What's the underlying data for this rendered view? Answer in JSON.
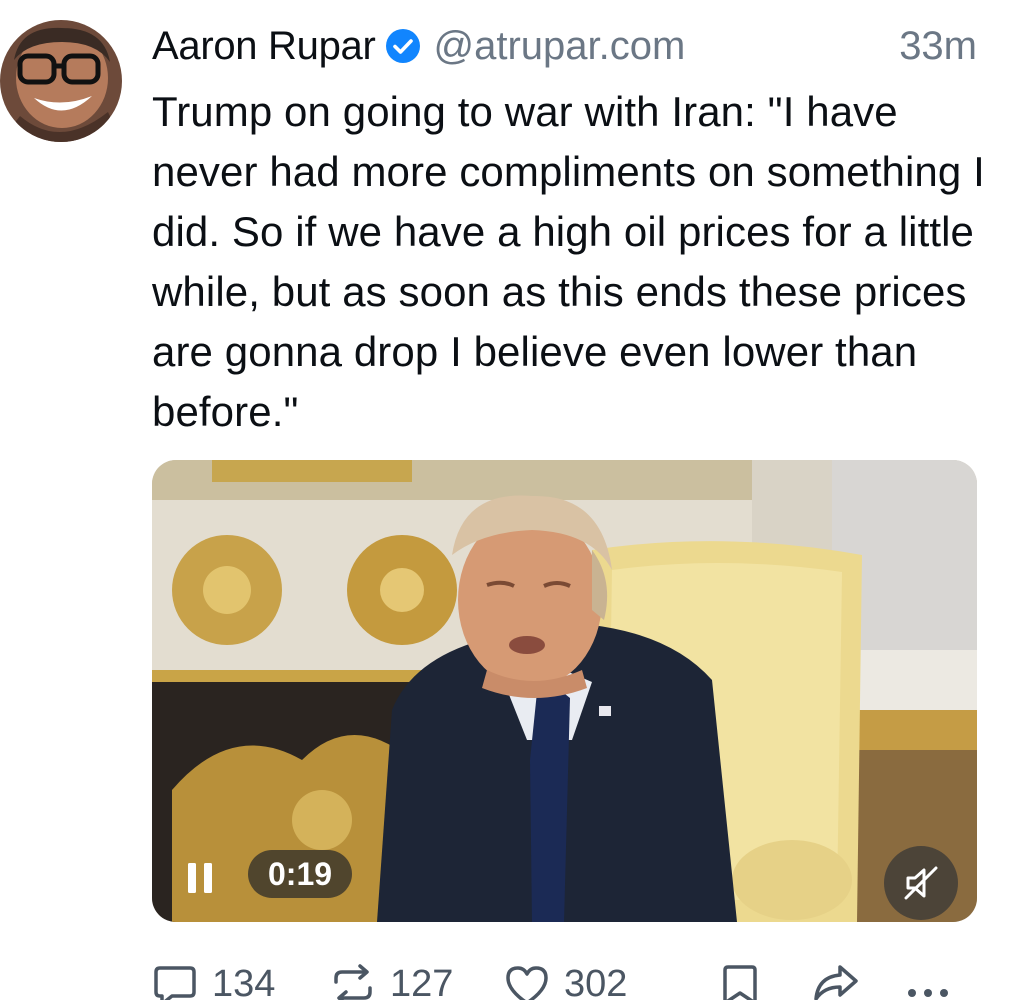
{
  "author": {
    "display_name": "Aaron Rupar",
    "handle": "@atrupar.com",
    "verified": true
  },
  "post": {
    "timestamp": "33m",
    "text": "Trump on going to war with Iran: \"I have never had more compliments on something I did. So if we have a high oil prices for a little while, but as soon as this ends these prices are gonna drop I believe even lower than before.\""
  },
  "video": {
    "elapsed": "0:19",
    "state": "playing",
    "muted": true
  },
  "actions": {
    "replies": "134",
    "reposts": "127",
    "likes": "302"
  },
  "colors": {
    "verified_blue": "#1185fe",
    "secondary_text": "#6b7785",
    "icon_gray": "#4b5663"
  }
}
